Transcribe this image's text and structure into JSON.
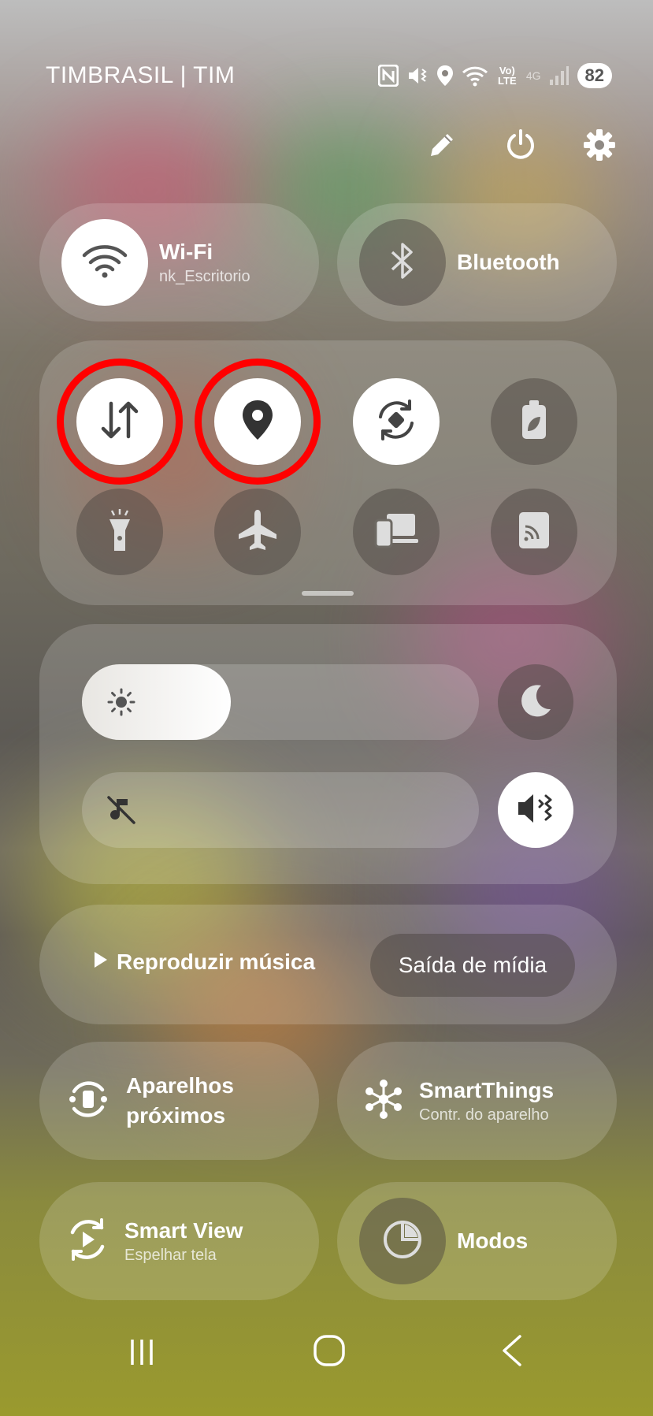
{
  "status_bar": {
    "carrier": "TIMBRASIL | TIM",
    "icons": [
      "nfc-icon",
      "vibrate-icon",
      "location-icon",
      "wifi-calling-icon",
      "volte-icon",
      "signal-icon"
    ],
    "volte_text": "Vo) LTE",
    "net_text": "4G",
    "battery": "82"
  },
  "top_actions": [
    "edit-icon",
    "power-icon",
    "settings-icon"
  ],
  "tiles": {
    "wifi": {
      "label": "Wi-Fi",
      "sub": "nk_Escritorio"
    },
    "bluetooth": {
      "label": "Bluetooth"
    }
  },
  "quick_toggles": [
    {
      "name": "mobile-data",
      "active": true
    },
    {
      "name": "location",
      "active": true
    },
    {
      "name": "auto-rotate",
      "active": true
    },
    {
      "name": "power-saving",
      "active": false
    },
    {
      "name": "flashlight",
      "active": false
    },
    {
      "name": "airplane-mode",
      "active": false
    },
    {
      "name": "link-to-windows",
      "active": false
    },
    {
      "name": "smart-view-cast",
      "active": false
    }
  ],
  "sliders": {
    "brightness_level": 0.28,
    "media_volume_level": 0.0
  },
  "media": {
    "play_label": "Reproduzir música",
    "output_label": "Saída de mídia"
  },
  "bottom_tiles": {
    "nearby": {
      "label_line1": "Aparelhos",
      "label_line2": "próximos"
    },
    "smartthings": {
      "label": "SmartThings",
      "sub": "Contr. do aparelho"
    },
    "smartview": {
      "label": "Smart View",
      "sub": "Espelhar tela"
    },
    "modes": {
      "label": "Modos"
    }
  },
  "colors": {
    "highlight_ring": "#ff0000",
    "active_toggle": "#ffffff"
  }
}
